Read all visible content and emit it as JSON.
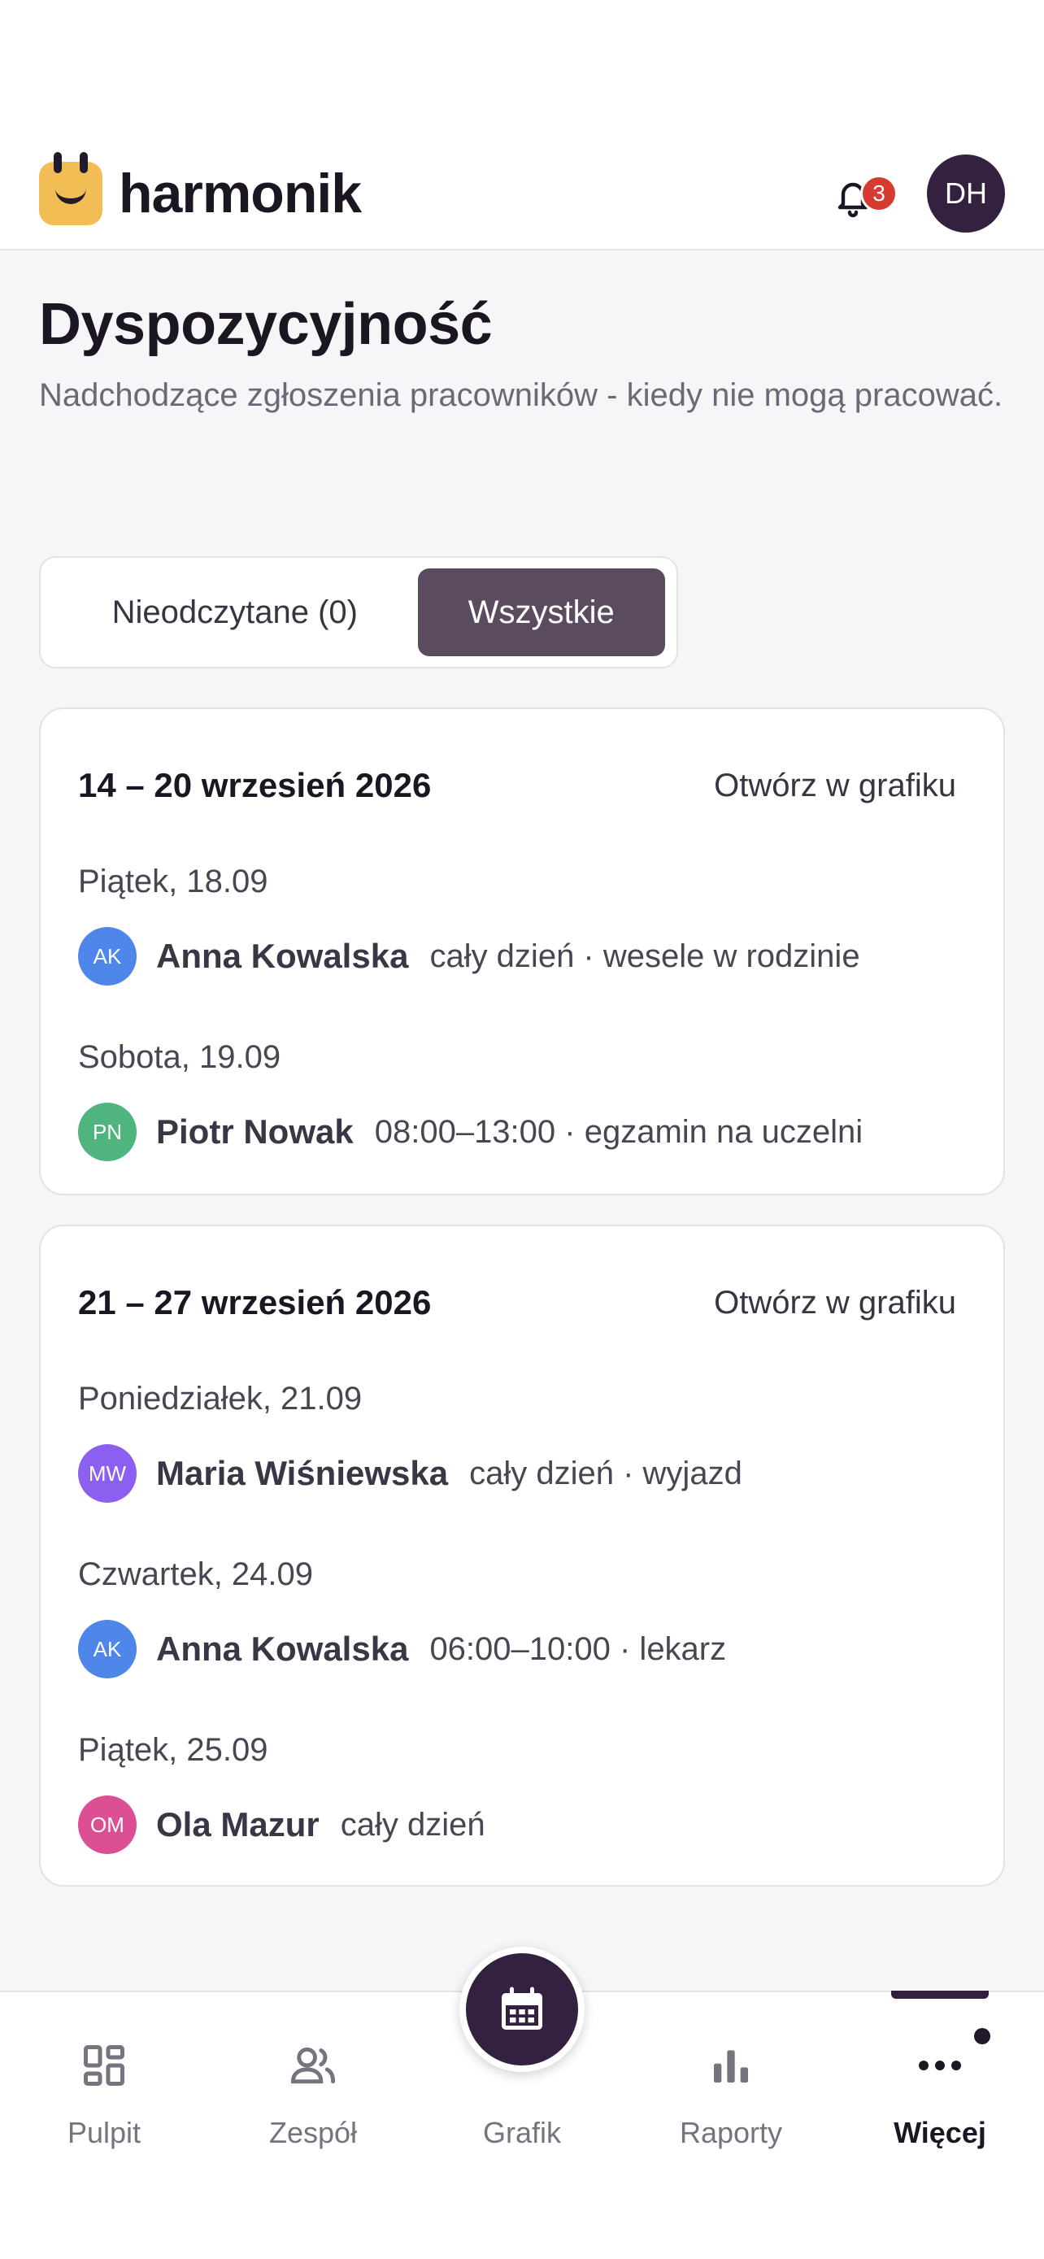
{
  "app": {
    "name": "harmonik",
    "user_initials": "DH",
    "notifications_count": "3"
  },
  "page": {
    "title": "Dyspozycyjność",
    "subtitle": "Nadchodzące zgłoszenia pracowników - kiedy nie mogą pracować."
  },
  "filter": {
    "unread_label": "Nieodczytane (0)",
    "all_label": "Wszystkie",
    "selected": "Wszystkie"
  },
  "weeks": [
    {
      "range": "14 – 20 wrzesień 2026",
      "open_label": "Otwórz w grafiku",
      "days": [
        {
          "label": "Piątek, 18.09",
          "initials": "AK",
          "name": "Anna Kowalska",
          "detail": "cały dzień · wesele w rodzinie",
          "color": "#4f86ea"
        },
        {
          "label": "Sobota, 19.09",
          "initials": "PN",
          "name": "Piotr Nowak",
          "detail": "08:00–13:00 · egzamin na uczelni",
          "color": "#4fb47e"
        }
      ]
    },
    {
      "range": "21 – 27 wrzesień 2026",
      "open_label": "Otwórz w grafiku",
      "days": [
        {
          "label": "Poniedziałek, 21.09",
          "initials": "MW",
          "name": "Maria Wiśniewska",
          "detail": "cały dzień · wyjazd",
          "color": "#8b5ff0"
        },
        {
          "label": "Czwartek, 24.09",
          "initials": "AK",
          "name": "Anna Kowalska",
          "detail": "06:00–10:00 · lekarz",
          "color": "#4f86ea"
        },
        {
          "label": "Piątek, 25.09",
          "initials": "OM",
          "name": "Ola Mazur",
          "detail": "cały dzień",
          "color": "#dc4f93"
        }
      ]
    }
  ],
  "nav": {
    "items": [
      {
        "label": "Pulpit",
        "icon": "dashboard-icon"
      },
      {
        "label": "Zespół",
        "icon": "team-icon"
      },
      {
        "label": "Grafik",
        "icon": "calendar-icon"
      },
      {
        "label": "Raporty",
        "icon": "bar-chart-icon"
      },
      {
        "label": "Więcej",
        "icon": "more-icon"
      }
    ],
    "active": "Więcej"
  }
}
